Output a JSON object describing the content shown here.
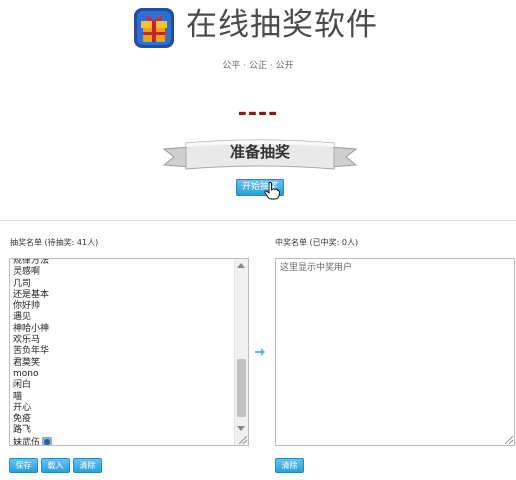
{
  "header": {
    "title": "在线抽奖软件",
    "slogan": "公平 · 公正 · 公开",
    "logo_icon": "gift-box-icon"
  },
  "draw": {
    "display": "----",
    "status": "准备抽奖",
    "start_label": "开始抽奖"
  },
  "candidates": {
    "label": "抽奖名单 (待抽奖: 41人)",
    "items": [
      "规律方法",
      "灵感啊",
      "几司",
      "还是基本",
      "你好帅",
      "遇见",
      "神哈小神",
      "欢乐马",
      "苦负年华",
      "君莫笑",
      "mono",
      "闲白",
      "喵",
      "开心",
      "免疫",
      "路飞",
      "妹武伍"
    ],
    "buttons": {
      "save": "保存",
      "import": "载入",
      "clear": "清除"
    }
  },
  "winners": {
    "label": "中奖名单 (已中奖: 0人)",
    "placeholder": "这里显示中奖用户",
    "buttons": {
      "clear": "清除"
    }
  },
  "colors": {
    "accent": "#2f9ed8",
    "draw_text": "#8b1a1a",
    "title": "#4a4a4a"
  }
}
